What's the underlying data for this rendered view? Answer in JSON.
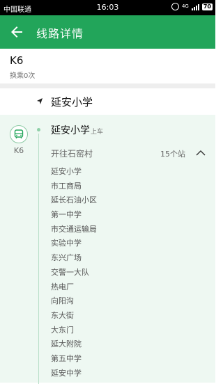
{
  "status_bar": {
    "carrier": "中国联通",
    "time": "16:03",
    "network": "4G",
    "battery": "70"
  },
  "app_bar": {
    "title": "线路详情",
    "back_icon": "arrow-left-icon"
  },
  "route": {
    "name": "K6",
    "transfer": "换乘0次"
  },
  "start": {
    "icon": "navigation-arrow-icon",
    "label": "延安小学"
  },
  "segment": {
    "bus_icon": "bus-icon",
    "bus_label": "K6",
    "board_stop": "延安小学",
    "board_tag": "上车",
    "direction": "开往石窑村",
    "stop_count": "15个站",
    "collapse_icon": "chevron-up-icon",
    "stops": [
      "延安小学",
      "市工商局",
      "延长石油小区",
      "第一中学",
      "市交通运输局",
      "实验中学",
      "东兴广场",
      "交警一大队",
      "热电厂",
      "向阳沟",
      "东大街",
      "大东门",
      "延大附院",
      "第五中学",
      "延安中学"
    ]
  },
  "colors": {
    "primary": "#22a55a",
    "detail_background": "#eef8f2"
  }
}
